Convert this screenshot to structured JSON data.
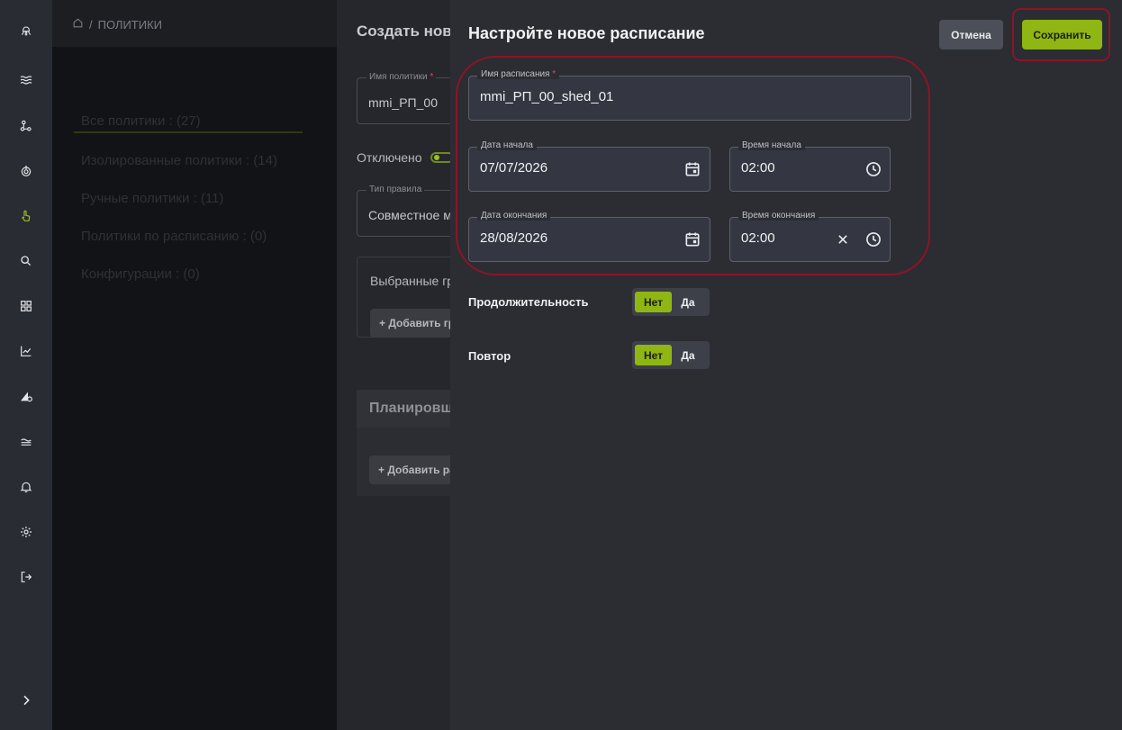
{
  "breadcrumb": {
    "current": "ПОЛИТИКИ"
  },
  "sidebar": {
    "items": [
      {
        "icon": "octopus-logo-icon"
      },
      {
        "icon": "waves-icon"
      },
      {
        "icon": "nodes-icon"
      },
      {
        "icon": "target-icon"
      },
      {
        "icon": "hand-pointer-icon",
        "active": true
      },
      {
        "icon": "search-icon"
      },
      {
        "icon": "dashboard-icon"
      },
      {
        "icon": "chart-icon"
      },
      {
        "icon": "ruler-gear-icon"
      },
      {
        "icon": "layers-icon"
      },
      {
        "icon": "bell-icon"
      },
      {
        "icon": "gear-icon"
      },
      {
        "icon": "logout-icon"
      },
      {
        "icon": "chevron-right-icon"
      }
    ]
  },
  "background": {
    "filters": [
      "Все политики : (27)",
      "Изолированные политики : (14)",
      "Ручные политики : (11)",
      "Политики по расписанию : (0)",
      "Конфигурации : (0)"
    ]
  },
  "policy_panel": {
    "title": "Создать новую политику",
    "policy_name_label": "Имя политики",
    "policy_name_value": "mmi_РП_00",
    "disabled_label": "Отключено",
    "rule_type_label": "Тип правила",
    "rule_type_value": "Совместное место",
    "selected_groups_label": "Выбранные группы",
    "add_group_button": "+ Добавить группу",
    "scheduler_label": "Планировщик",
    "add_schedule_button": "+ Добавить расписание"
  },
  "dialog": {
    "title": "Настройте новое расписание",
    "cancel_label": "Отмена",
    "save_label": "Сохранить",
    "required_mark": "*",
    "schedule_name_label": "Имя расписания",
    "schedule_name_value": "mmi_РП_00_shed_01",
    "start_date_label": "Дата начала",
    "start_date_value": "07/07/2026",
    "start_time_label": "Время начала",
    "start_time_value": "02:00",
    "end_date_label": "Дата окончания",
    "end_date_value": "28/08/2026",
    "end_time_label": "Время окончания",
    "end_time_value": "02:00",
    "duration_label": "Продолжительность",
    "repeat_label": "Повтор",
    "no_label": "Нет",
    "yes_label": "Да"
  },
  "colors": {
    "accent": "#8fb613",
    "highlight_ring": "#8d1427",
    "dialog_bg": "#2b2d33",
    "sidebar_bg": "#2a2c33"
  }
}
